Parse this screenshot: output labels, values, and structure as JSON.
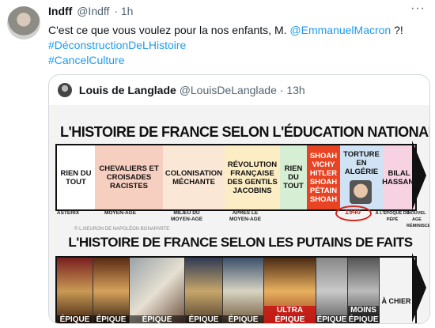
{
  "tweet": {
    "name": "Indff",
    "handle": "@Indff",
    "time": "· 1h",
    "more": "···",
    "text_line1": "C'est ce que vous voulez pour la nos enfants, M. ",
    "mention": "@EmmanuelMacron",
    "text_end": " ?!",
    "hashtag1": "#DéconstructionDeLHistoire",
    "hashtag2": "#CancelCulture"
  },
  "quoted": {
    "name": "Louis de Langlade",
    "handle": "@LouisDeLanglade",
    "time": "· 13h"
  },
  "image": {
    "title_top": "L'HISTOIRE DE FRANCE SELON L'ÉDUCATION NATIONALE",
    "segments": [
      "RIEN DU TOUT",
      "CHEVALIERS ET CROISADES RACISTES",
      "COLONISATION MÉCHANTE",
      "RÉVOLUTION FRANÇAISE DES GENTILS JACOBINS",
      "RIEN DU TOUT",
      "SHOAH VICHY HITLER SHOAH PÉTAIN SHOAH",
      "TORTURE EN ALGÉRIE",
      "BILAL HASSANI"
    ],
    "timeline_labels": [
      "ASTÉRIX",
      "MOYEN-AGE",
      "MILIEU DU MOYEN-AGE",
      "APRÈS LE MOYEN-AGE",
      "1940",
      "À L'ÉPOQUE DE PÉPÉ",
      "NOUVEL AGE RÉMINISCENT"
    ],
    "author_credit": "© L.NEURON DE NAPOLÉON BONAPARTE",
    "title_bottom": "L'HISTOIRE DE FRANCE SELON LES PUTAINS DE FAITS",
    "tags": [
      "ÉPIQUE",
      "ÉPIQUE",
      "ÉPIQUE",
      "ÉPIQUE",
      "ÉPIQUE",
      "ULTRA ÉPIQUE",
      "ÉPIQUE",
      "MOINS ÉPIQUE"
    ],
    "last_label": "À CHIER"
  },
  "colors": {
    "accent": "#1d9bf0",
    "shoah_red": "#e84322",
    "circle_red": "#d2281c"
  }
}
